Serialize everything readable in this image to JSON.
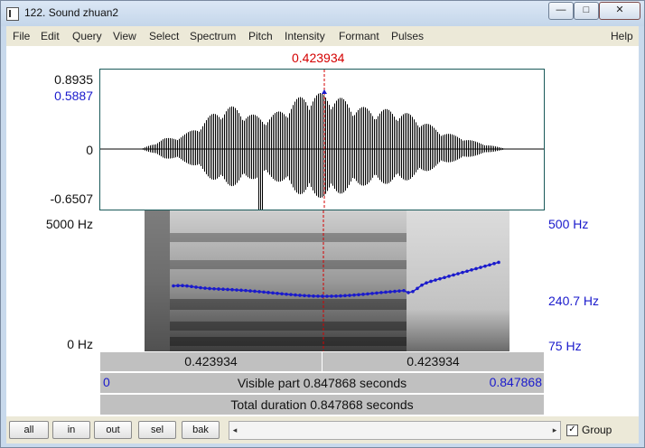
{
  "window": {
    "title": "122. Sound zhuan2",
    "minimize": "—",
    "maximize": "□",
    "close": "✕"
  },
  "menu": [
    "File",
    "Edit",
    "Query",
    "View",
    "Select",
    "Spectrum",
    "Pitch",
    "Intensity",
    "Formant",
    "Pulses"
  ],
  "menu_help": "Help",
  "cursor": {
    "time_label": "0.423934",
    "time": 0.423934
  },
  "waveform": {
    "y_max_label": "0.8935",
    "y_cursor_label": "0.5887",
    "y_zero_label": "0",
    "y_min_label": "-0.6507"
  },
  "spectrogram": {
    "freq_top_label": "5000 Hz",
    "freq_bottom_label": "0 Hz",
    "pitch_top_label": "500 Hz",
    "pitch_cursor_label": "240.7 Hz",
    "pitch_bottom_label": "75 Hz"
  },
  "bars": {
    "left_time": "0.423934",
    "right_time": "0.423934",
    "visible_start": "0",
    "visible_text": "Visible part 0.847868 seconds",
    "visible_end": "0.847868",
    "total_text": "Total duration 0.847868 seconds"
  },
  "buttons": {
    "all": "all",
    "in": "in",
    "out": "out",
    "sel": "sel",
    "bak": "bak"
  },
  "scrollbar": {
    "left_arrow": "◂",
    "right_arrow": "▸"
  },
  "group": {
    "label": "Group",
    "checked": "✓"
  },
  "colors": {
    "cursor": "#d40000",
    "pitch": "#1a1acc",
    "axis_blue": "#1a1acc"
  }
}
